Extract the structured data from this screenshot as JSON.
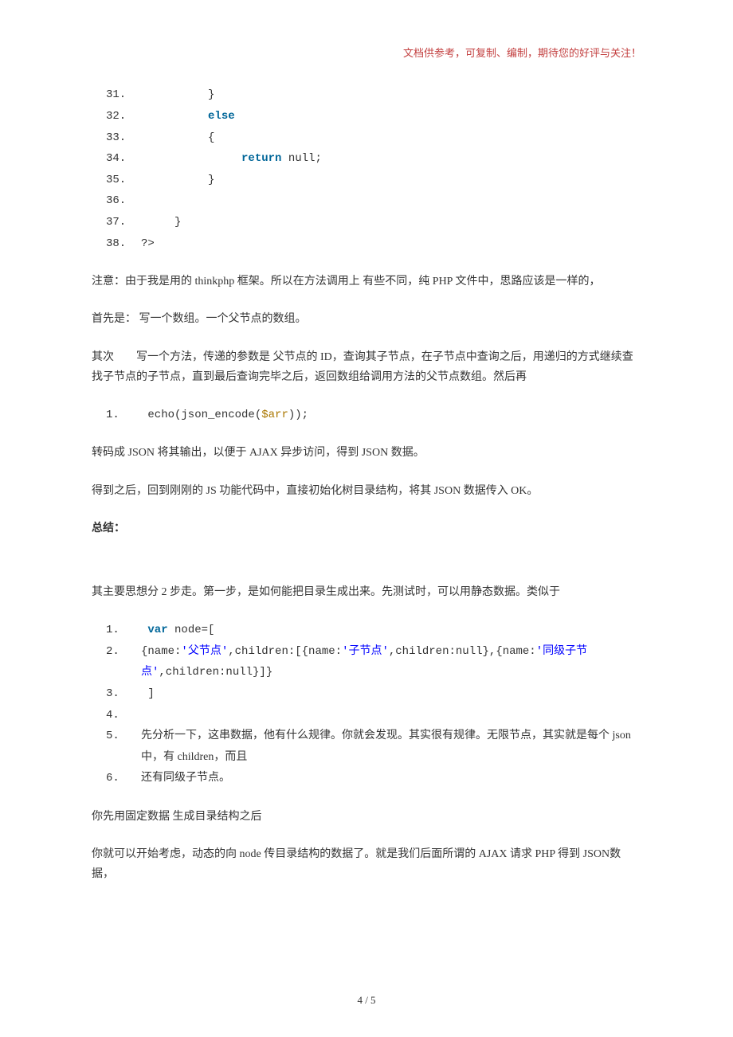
{
  "header_note": "文档供参考，可复制、编制，期待您的好评与关注！",
  "block1": {
    "l31_ln": "31.",
    "l31_code": "          }",
    "l32_ln": "32.",
    "l32_kw": "else",
    "l33_ln": "33.",
    "l33_code": "          {",
    "l34_ln": "34.",
    "l34_kw": "return",
    "l34_rest": " null;",
    "l35_ln": "35.",
    "l35_code": "          }",
    "l36_ln": "36.",
    "l36_code": "",
    "l37_ln": "37.",
    "l37_code": "     }",
    "l38_ln": "38.",
    "l38_code": "?>"
  },
  "p1": "注意：由于我是用的 thinkphp 框架。所以在方法调用上 有些不同，纯 PHP 文件中，思路应该是一样的，",
  "p2": "首先是： 写一个数组。一个父节点的数组。",
  "p3": "其次　　写一个方法，传递的参数是 父节点的 ID，查询其子节点，在子节点中查询之后，用递归的方式继续查找子节点的子节点，直到最后查询完毕之后，返回数组给调用方法的父节点数组。然后再",
  "block2": {
    "l1_ln": "1.",
    "l1_a": " echo(json_encode(",
    "l1_var": "$arr",
    "l1_b": "));"
  },
  "p4": "转码成 JSON 将其输出，以便于 AJAX 异步访问，得到 JSON 数据。",
  "p5": "得到之后，回到刚刚的 JS 功能代码中，直接初始化树目录结构，将其 JSON 数据传入 OK。",
  "p6": "总结：",
  "p7": "其主要思想分 2 步走。第一步，是如何能把目录生成出来。先测试时，可以用静态数据。类似于",
  "block3": {
    "l1_ln": "1.",
    "l1_kw": "var",
    "l1_rest": " node=[",
    "l2_ln": "2.",
    "l2_a": "     {name:",
    "l2_s1": "'父节点'",
    "l2_b": ",children:[{name:",
    "l2_s2": "'子节点'",
    "l2_c": ",children:null},{name:",
    "l2_s3": "'同级子节点'",
    "l2_d": ",children:null}]}",
    "l3_ln": "3.",
    "l3_code": " ]",
    "l4_ln": "4.",
    "l4_code": " ",
    "l5_ln": "5.",
    "l5_text": " 先分析一下，这串数据，他有什么规律。你就会发现。其实很有规律。无限节点，其实就是每个 json 中，有 children，而且",
    "l6_ln": "6.",
    "l6_text": " 还有同级子节点。"
  },
  "p8": "你先用固定数据 生成目录结构之后",
  "p9": "你就可以开始考虑，动态的向 node 传目录结构的数据了。就是我们后面所谓的 AJAX 请求 PHP 得到 JSON数据，",
  "footer": "4 / 5"
}
